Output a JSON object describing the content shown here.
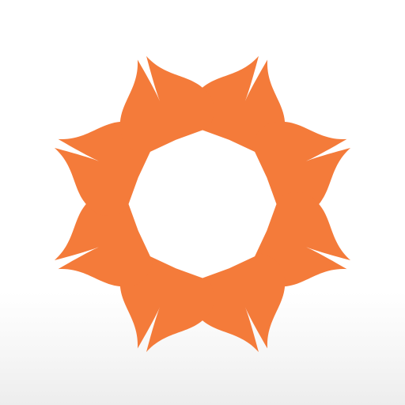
{
  "icon": {
    "logo": "eight-petal-star-logo-icon",
    "colors": {
      "petal": "#F47B3A",
      "background_top": "#FFFFFF",
      "background_bottom": "#EDEDED"
    },
    "petal_count": 8
  }
}
